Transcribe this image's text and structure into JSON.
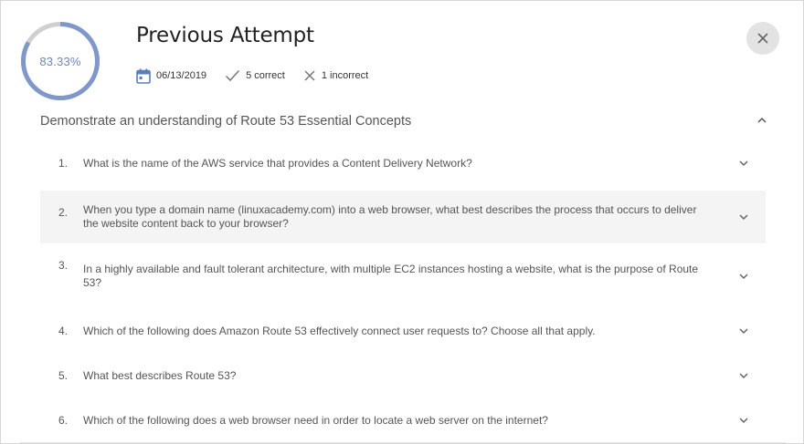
{
  "header": {
    "score_percent": 83.33,
    "score_label": "83.33%",
    "title": "Previous Attempt",
    "date": "06/13/2019",
    "correct": "5 correct",
    "incorrect": "1 incorrect",
    "ring_colors": {
      "progress": "#7f98c9",
      "track": "#d0d0d0"
    }
  },
  "section": {
    "title": "Demonstrate an understanding of Route 53 Essential Concepts"
  },
  "questions": [
    {
      "num": "1.",
      "text": "What is the name of the AWS service that provides a Content Delivery Network?"
    },
    {
      "num": "2.",
      "text": "When you type a domain name (linuxacademy.com) into a web browser, what best describes the process that occurs to deliver the website content back to your browser?"
    },
    {
      "num": "3.",
      "text": "In a highly available and fault tolerant architecture, with multiple EC2 instances hosting a website, what is the purpose of Route 53?"
    },
    {
      "num": "4.",
      "text": "Which of the following does Amazon Route 53 effectively connect user requests to? Choose all that apply."
    },
    {
      "num": "5.",
      "text": "What best describes Route 53?"
    },
    {
      "num": "6.",
      "text": "Which of the following does a web browser need in order to locate a web server on the internet?"
    }
  ],
  "icons": {
    "date": "calendar-icon",
    "correct": "check-icon",
    "incorrect": "x-icon",
    "close": "close-icon",
    "collapse": "chevron-up-icon",
    "expand": "chevron-down-icon"
  }
}
